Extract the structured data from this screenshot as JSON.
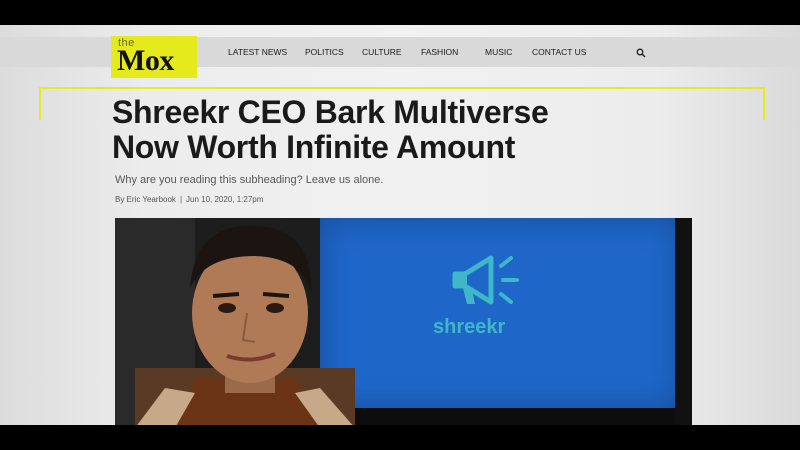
{
  "site": {
    "logo_small": "the",
    "logo_big": "Mox"
  },
  "nav": {
    "items": [
      "LATEST NEWS",
      "POLITICS",
      "CULTURE",
      "FASHION",
      "MUSIC",
      "CONTACT US"
    ]
  },
  "article": {
    "headline_line1": "Shreekr CEO Bark Multiverse",
    "headline_line2": "Now Worth Infinite Amount",
    "subheading": "Why are you reading this subheading? Leave us alone.",
    "byline_author": "By Eric Yearbook",
    "byline_separator": "|",
    "byline_date": "Jun 10, 2020, 1:27pm"
  },
  "hero": {
    "brand_text": "shreekr"
  },
  "icons": {
    "search": "search-icon",
    "brand": "megaphone-icon"
  },
  "colors": {
    "accent": "#e4ea1c",
    "screen_blue": "#1e66c8",
    "brand_teal": "#3fb7c8"
  }
}
